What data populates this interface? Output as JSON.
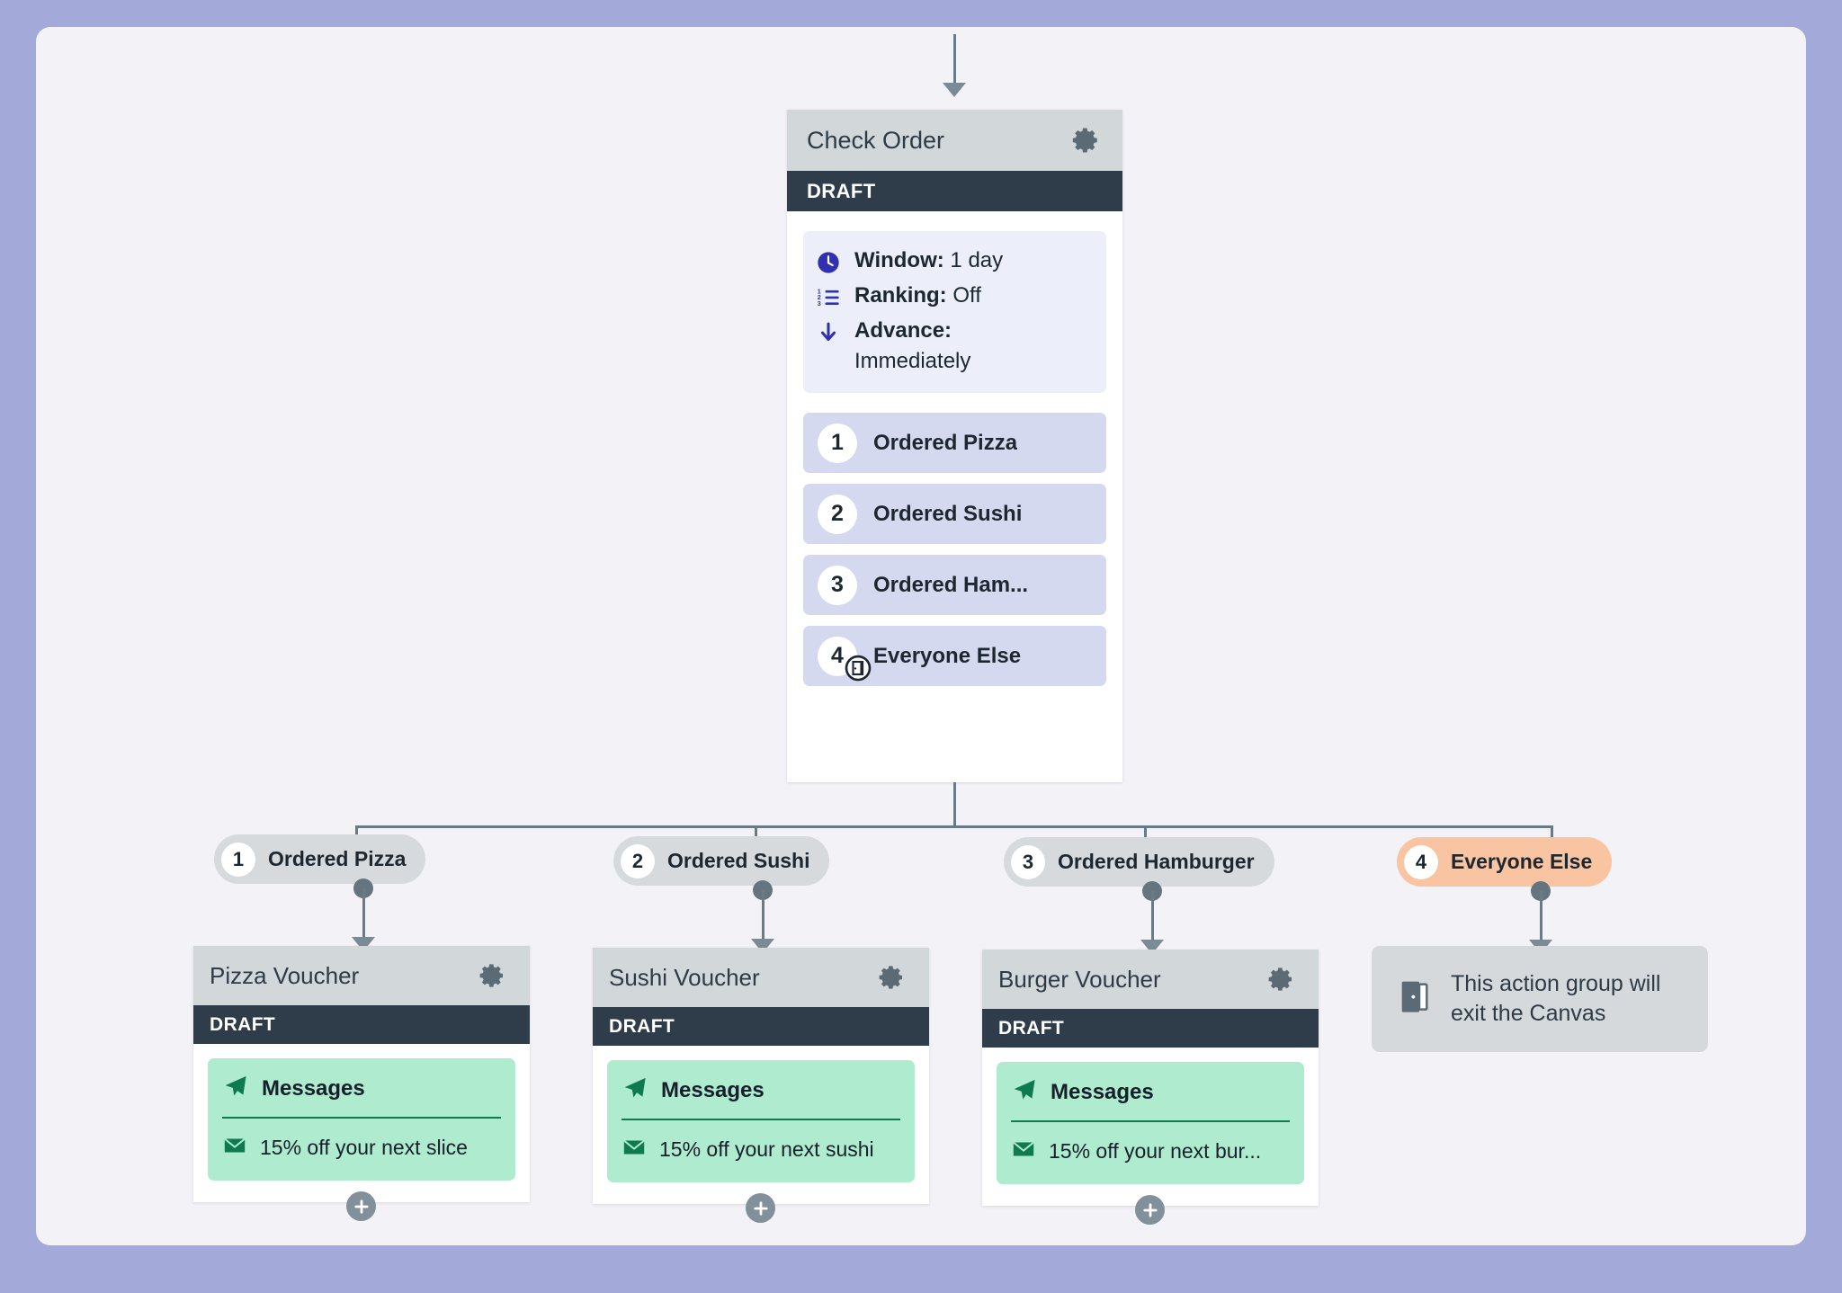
{
  "colors": {
    "frame_border": "#a3a9d8",
    "canvas_bg": "#f3f2f7",
    "node_header": "#d2d7da",
    "status_band": "#2f3d4b",
    "info_panel": "#eceefa",
    "branch_item": "#d5d9ef",
    "pill_default": "#d6dadd",
    "pill_accent": "#f9c4a2",
    "message_block": "#aeebcf",
    "connector": "#6b7b86",
    "accent_blue": "#3030b0",
    "accent_green": "#0f7a50"
  },
  "check_order": {
    "title": "Check Order",
    "gear_icon": "gear-icon",
    "status": "DRAFT",
    "info": [
      {
        "icon": "clock-icon",
        "label": "Window:",
        "value": "1 day",
        "inline": true
      },
      {
        "icon": "ranking-list-icon",
        "label": "Ranking:",
        "value": "Off",
        "inline": true
      },
      {
        "icon": "down-arrow-icon",
        "label": "Advance:",
        "value": "Immediately",
        "inline": false
      }
    ],
    "branches": [
      {
        "number": "1",
        "label": "Ordered Pizza"
      },
      {
        "number": "2",
        "label": "Ordered Sushi"
      },
      {
        "number": "3",
        "label": "Ordered Ham..."
      },
      {
        "number": "4",
        "label": "Everyone Else"
      }
    ],
    "cursor_icon": "exit-door-cursor-icon"
  },
  "pills": [
    {
      "number": "1",
      "label": "Ordered Pizza",
      "accent": false
    },
    {
      "number": "2",
      "label": "Ordered Sushi",
      "accent": false
    },
    {
      "number": "3",
      "label": "Ordered Hamburger",
      "accent": false
    },
    {
      "number": "4",
      "label": "Everyone Else",
      "accent": true
    }
  ],
  "vouchers": [
    {
      "title": "Pizza Voucher",
      "gear_icon": "gear-icon",
      "status": "DRAFT",
      "messages_label": "Messages",
      "messages_icon": "paper-plane-icon",
      "item_icon": "envelope-icon",
      "item_label": "15% off your next slice",
      "add_icon": "plus-icon"
    },
    {
      "title": "Sushi Voucher",
      "gear_icon": "gear-icon",
      "status": "DRAFT",
      "messages_label": "Messages",
      "messages_icon": "paper-plane-icon",
      "item_icon": "envelope-icon",
      "item_label": "15% off your next sushi",
      "add_icon": "plus-icon"
    },
    {
      "title": "Burger Voucher",
      "gear_icon": "gear-icon",
      "status": "DRAFT",
      "messages_label": "Messages",
      "messages_icon": "paper-plane-icon",
      "item_icon": "envelope-icon",
      "item_label": "15% off your next bur...",
      "add_icon": "plus-icon"
    }
  ],
  "exit_note": {
    "icon": "open-door-icon",
    "text": "This action group will exit the Canvas"
  }
}
